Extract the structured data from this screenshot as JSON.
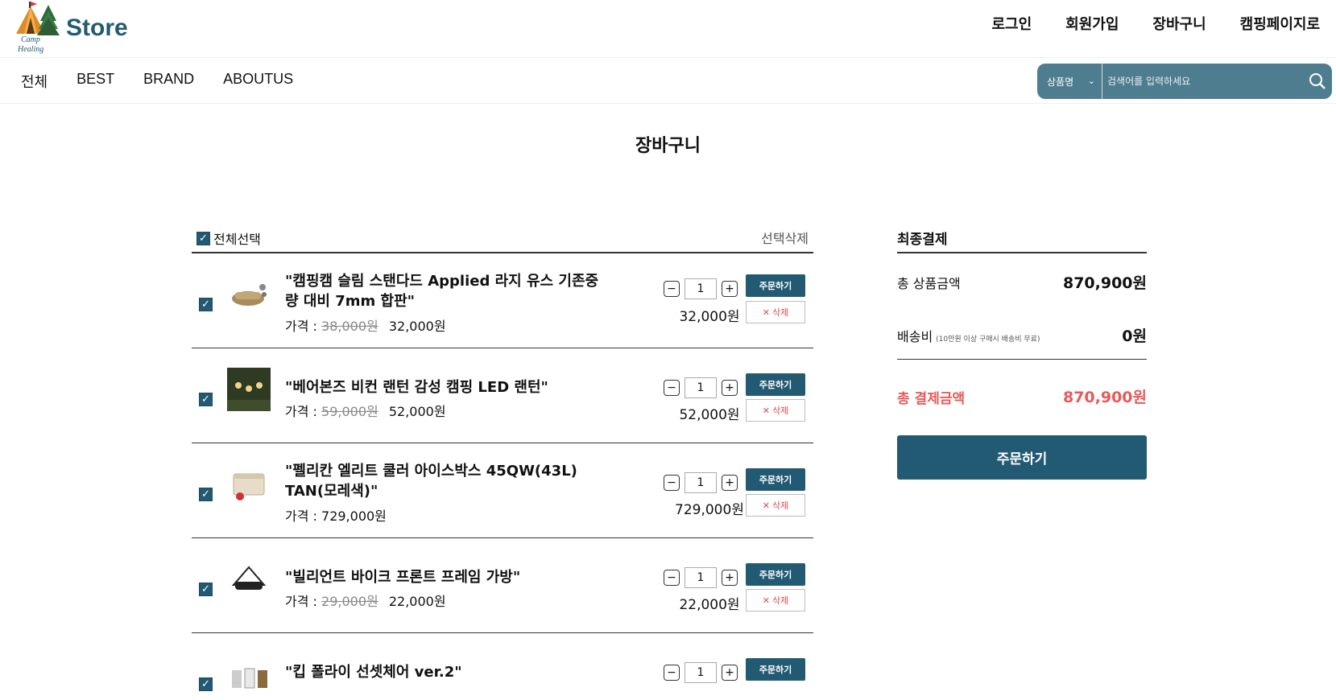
{
  "brand": {
    "logo_text": "Store",
    "logo_script_top": "Camp",
    "logo_script_bottom": "Healing"
  },
  "top_links": [
    "로그인",
    "회원가입",
    "장바구니",
    "캠핑페이지로"
  ],
  "nav": [
    "전체",
    "BEST",
    "BRAND",
    "ABOUTUS"
  ],
  "search": {
    "category": "상품명",
    "placeholder": "검색어를 입력하세요"
  },
  "page_title": "장바구니",
  "cart": {
    "select_all_label": "전체선택",
    "delete_selected_label": "선택삭제",
    "price_prefix": "가격 :",
    "order_label": "주문하기",
    "delete_label": "삭제",
    "items": [
      {
        "name": "\"캠핑캠 슬림 스탠다드 Applied 라지 유스 기존중량 대비 7mm 합판\"",
        "original_price": "38,000원",
        "price": "32,000원",
        "qty": "1",
        "subtotal": "32,000원",
        "checked": true
      },
      {
        "name": "\"베어본즈 비컨 랜턴 감성 캠핑 LED 랜턴\"",
        "original_price": "59,000원",
        "price": "52,000원",
        "qty": "1",
        "subtotal": "52,000원",
        "checked": true
      },
      {
        "name": "\"펠리칸 엘리트 쿨러 아이스박스 45QW(43L) TAN(모레색)\"",
        "original_price": "",
        "price": "729,000원",
        "qty": "1",
        "subtotal": "729,000원",
        "checked": true
      },
      {
        "name": "\"빌리언트 바이크 프론트 프레임 가방\"",
        "original_price": "29,000원",
        "price": "22,000원",
        "qty": "1",
        "subtotal": "22,000원",
        "checked": true
      },
      {
        "name": "\"킵 폴라이 선셋체어 ver.2\"",
        "original_price": "",
        "price": "",
        "qty": "1",
        "subtotal": "",
        "checked": true
      }
    ]
  },
  "summary": {
    "title": "최종결제",
    "product_total_label": "총 상품금액",
    "product_total": "870,900원",
    "shipping_label": "배송비",
    "shipping_note": "(10만원 이상 구매시 배송비 무료)",
    "shipping": "0원",
    "grand_total_label": "총 결제금액",
    "grand_total": "870,900원",
    "checkout_label": "주문하기"
  },
  "colors": {
    "brand": "#235a73",
    "search_bg": "#4f7d90",
    "accent_red": "#e85a5a"
  }
}
